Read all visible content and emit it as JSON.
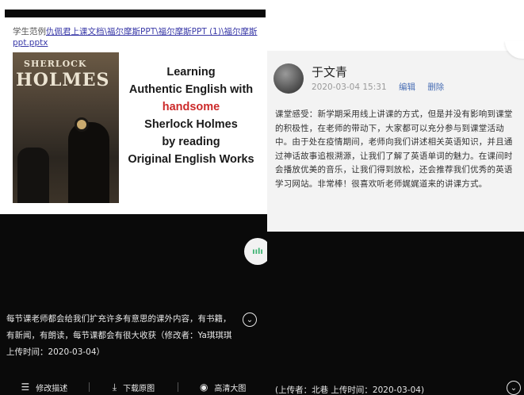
{
  "left": {
    "path_prefix": "学生范例",
    "path_link": "仇佩君上课文档\\福尔摩斯PPT\\福尔摩斯PPT (1)\\福尔摩斯ppt.pptx",
    "book_cover_line1": "SHERLOCK",
    "book_cover_line2": "HOLMES",
    "slide_title": {
      "line1": "Learning",
      "line2": "Authentic English with",
      "line3": "handsome",
      "line4": "Sherlock Holmes",
      "line5": "by reading",
      "line6": "Original English Works"
    },
    "description": "每节课老师都会给我们扩充许多有意思的课外内容，有书籍，有新闻，有朗读，每节课都会有很大收获（修改者：Ya琪琪琪 上传时间：2020-03-04）",
    "actions": {
      "edit_label": "修改描述",
      "download_label": "下载原图",
      "hd_label": "高清大图"
    }
  },
  "right": {
    "author": "于文青",
    "timestamp": "2020-03-04 15:31",
    "edit_label": "编辑",
    "delete_label": "删除",
    "content": "课堂感受：新学期采用线上讲课的方式，但是并没有影响到课堂的积极性，在老师的带动下，大家都可以充分参与到课堂活动中。由于处在疫情期间，老师向我们讲述相关英语知识，并且通过神话故事追根溯源，让我们了解了英语单词的魅力。在课间时会播放优美的音乐，让我们得到放松，还会推荐我们优秀的英语学习网站。非常棒！很喜欢听老师娓娓道来的讲课方式。",
    "uploader": "(上传者：北巷 上传时间：2020-03-04)"
  },
  "icons": {
    "menu": "menu-icon",
    "download": "download-icon",
    "eye": "eye-icon",
    "chevron": "chevron-down-icon",
    "audio": "audio-wave-icon"
  },
  "colors": {
    "link": "#3a3aa8",
    "accent_red": "#cc2a2a",
    "meta_link": "#4a6fb5",
    "audio_green": "#3cb371"
  }
}
